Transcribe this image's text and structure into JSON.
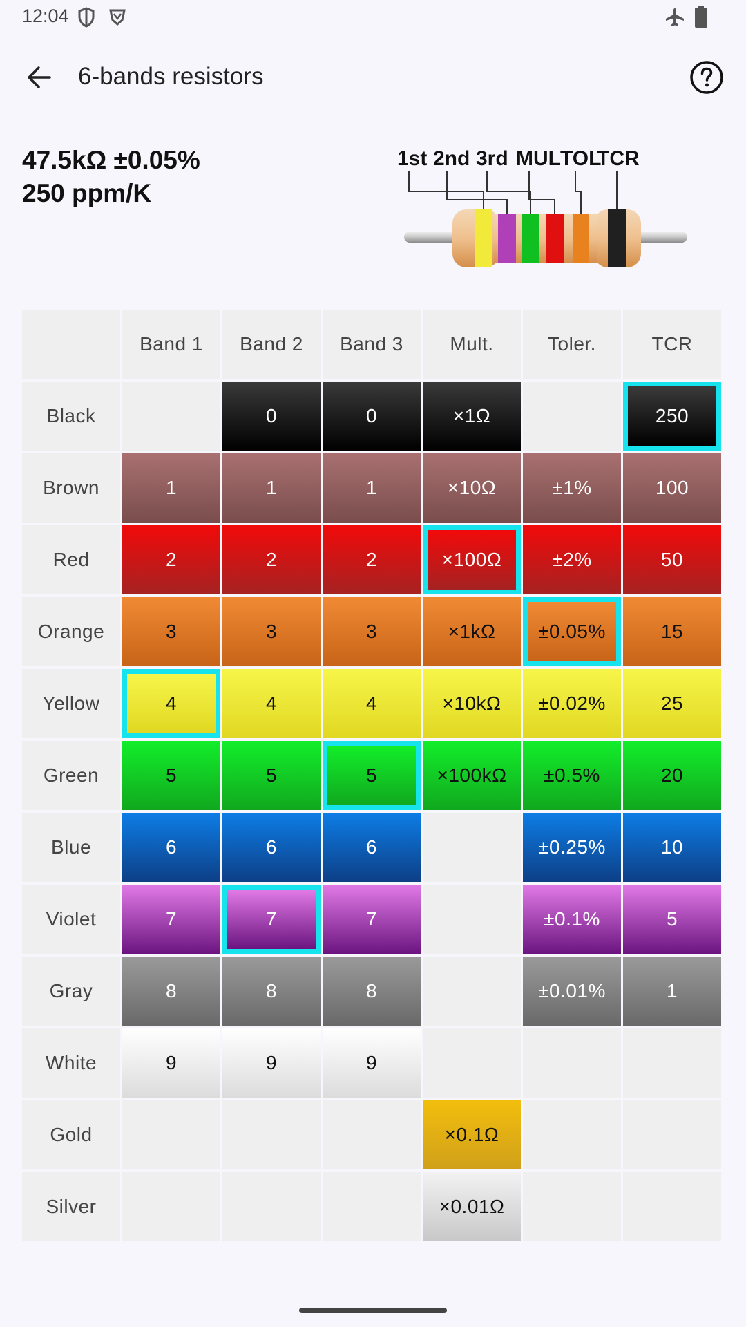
{
  "status_bar": {
    "time": "12:04"
  },
  "app_bar": {
    "title": "6-bands resistors"
  },
  "result": {
    "value_line": "47.5kΩ ±0.05%",
    "tcr_line": "250 ppm/K"
  },
  "diagram": {
    "labels": [
      "1st",
      "2nd",
      "3rd",
      "MUL",
      "TOL",
      "TCR"
    ],
    "band_colors": [
      "#f2ea3a",
      "#b040b8",
      "#10c020",
      "#e01010",
      "#e8821f",
      "#202020"
    ]
  },
  "table": {
    "headers": [
      "",
      "Band 1",
      "Band 2",
      "Band 3",
      "Mult.",
      "Toler.",
      "TCR"
    ],
    "rows": [
      {
        "label": "Black",
        "top": "#3a3a3a",
        "bottom": "#000000",
        "fg": "#ffffff",
        "cells": [
          "",
          "0",
          "0",
          "×1Ω",
          "",
          "250"
        ]
      },
      {
        "label": "Brown",
        "top": "#a97070",
        "bottom": "#7a4d4d",
        "fg": "#ffffff",
        "cells": [
          "1",
          "1",
          "1",
          "×10Ω",
          "±1%",
          "100"
        ]
      },
      {
        "label": "Red",
        "top": "#f20a0a",
        "bottom": "#a52222",
        "fg": "#ffffff",
        "cells": [
          "2",
          "2",
          "2",
          "×100Ω",
          "±2%",
          "50"
        ]
      },
      {
        "label": "Orange",
        "top": "#f08a34",
        "bottom": "#c86418",
        "fg": "#111111",
        "cells": [
          "3",
          "3",
          "3",
          "×1kΩ",
          "±0.05%",
          "15"
        ]
      },
      {
        "label": "Yellow",
        "top": "#f7f54a",
        "bottom": "#e0d822",
        "fg": "#111111",
        "cells": [
          "4",
          "4",
          "4",
          "×10kΩ",
          "±0.02%",
          "25"
        ]
      },
      {
        "label": "Green",
        "top": "#12ee2a",
        "bottom": "#11a81f",
        "fg": "#111111",
        "cells": [
          "5",
          "5",
          "5",
          "×100kΩ",
          "±0.5%",
          "20"
        ]
      },
      {
        "label": "Blue",
        "top": "#0d7de6",
        "bottom": "#0d3f86",
        "fg": "#ffffff",
        "cells": [
          "6",
          "6",
          "6",
          "",
          "±0.25%",
          "10"
        ]
      },
      {
        "label": "Violet",
        "top": "#e17ae6",
        "bottom": "#6b1580",
        "fg": "#ffffff",
        "cells": [
          "7",
          "7",
          "7",
          "",
          "±0.1%",
          "5"
        ]
      },
      {
        "label": "Gray",
        "top": "#9a9a9a",
        "bottom": "#696969",
        "fg": "#ffffff",
        "cells": [
          "8",
          "8",
          "8",
          "",
          "±0.01%",
          "1"
        ]
      },
      {
        "label": "White",
        "top": "#ffffff",
        "bottom": "#dcdcdc",
        "fg": "#111111",
        "cells": [
          "9",
          "9",
          "9",
          "",
          "",
          ""
        ]
      },
      {
        "label": "Gold",
        "top": "#f2be0d",
        "bottom": "#d0a01a",
        "fg": "#111111",
        "cells": [
          "",
          "",
          "",
          "×0.1Ω",
          "",
          ""
        ]
      },
      {
        "label": "Silver",
        "top": "#f2f2f2",
        "bottom": "#c8c8c8",
        "fg": "#111111",
        "cells": [
          "",
          "",
          "",
          "×0.01Ω",
          "",
          ""
        ]
      }
    ],
    "selected": [
      {
        "row": 4,
        "col": 0
      },
      {
        "row": 7,
        "col": 1
      },
      {
        "row": 5,
        "col": 2
      },
      {
        "row": 2,
        "col": 3
      },
      {
        "row": 3,
        "col": 4
      },
      {
        "row": 0,
        "col": 5
      }
    ],
    "selection_color": "#17e3ec"
  }
}
